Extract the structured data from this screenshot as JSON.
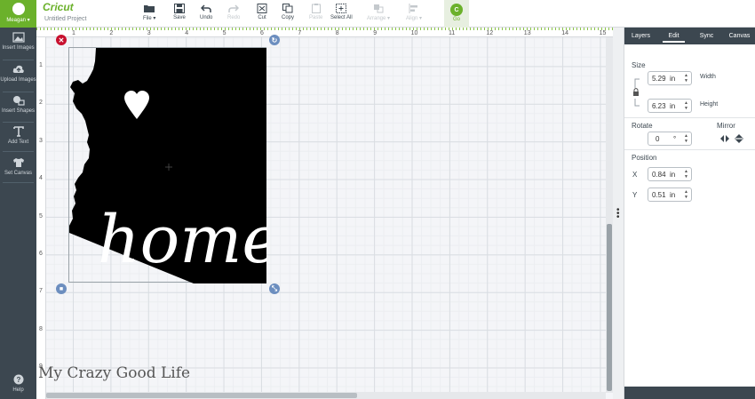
{
  "app": {
    "logo": "Cricut",
    "project_title": "Untitled Project"
  },
  "user": {
    "name": "Meagan ▾"
  },
  "sidebar": {
    "items": [
      {
        "label": "Insert Images",
        "icon": "image-icon"
      },
      {
        "label": "Upload Images",
        "icon": "cloud-upload-icon"
      },
      {
        "label": "Insert Shapes",
        "icon": "shapes-icon"
      },
      {
        "label": "Add Text",
        "icon": "text-icon"
      },
      {
        "label": "Set Canvas",
        "icon": "shirt-icon"
      }
    ],
    "help": "Help"
  },
  "toolbar": {
    "file": "File ▾",
    "save": "Save",
    "undo": "Undo",
    "redo": "Redo",
    "cut": "Cut",
    "copy": "Copy",
    "paste": "Paste",
    "select_all": "Select All",
    "arrange": "Arrange ▾",
    "align": "Align ▾",
    "go_letter": "C",
    "go": "Go"
  },
  "ruler": {
    "top": [
      "1",
      "2",
      "3",
      "4",
      "5",
      "6",
      "7",
      "8",
      "9",
      "10",
      "11",
      "12",
      "13",
      "14",
      "15"
    ],
    "left": [
      "1",
      "2",
      "3",
      "4",
      "5",
      "6",
      "7",
      "8",
      "9"
    ]
  },
  "design": {
    "text": "home."
  },
  "watermark": "My Crazy Good Life",
  "panel": {
    "tabs": [
      "Layers",
      "Edit",
      "Sync",
      "Canvas"
    ],
    "active_tab": "Edit",
    "size_label": "Size",
    "width": {
      "value": "5.29",
      "unit": "in",
      "label": "Width"
    },
    "height": {
      "value": "6.23",
      "unit": "in",
      "label": "Height"
    },
    "rotate_label": "Rotate",
    "rotate": {
      "value": "0",
      "unit": "°"
    },
    "mirror_label": "Mirror",
    "position_label": "Position",
    "x": {
      "label": "X",
      "value": "0.84",
      "unit": "in"
    },
    "y": {
      "label": "Y",
      "value": "0.51",
      "unit": "in"
    }
  },
  "colors": {
    "brand": "#6bb12b",
    "sidebar": "#3c4750",
    "delete": "#c8102e",
    "handle": "#6c8ebf"
  }
}
